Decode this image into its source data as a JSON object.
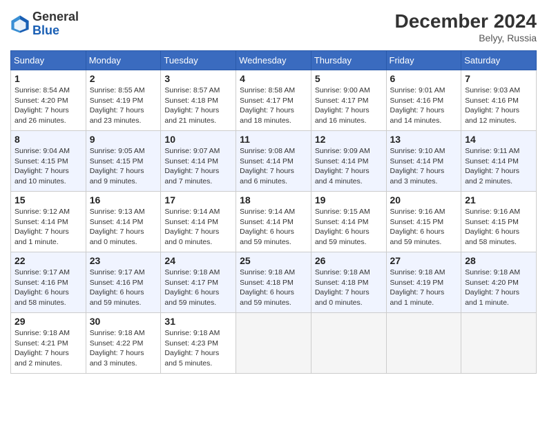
{
  "logo": {
    "text_general": "General",
    "text_blue": "Blue"
  },
  "header": {
    "month_year": "December 2024",
    "location": "Belyy, Russia"
  },
  "weekdays": [
    "Sunday",
    "Monday",
    "Tuesday",
    "Wednesday",
    "Thursday",
    "Friday",
    "Saturday"
  ],
  "weeks": [
    [
      {
        "day": "1",
        "sunrise": "8:54 AM",
        "sunset": "4:20 PM",
        "daylight": "7 hours and 26 minutes."
      },
      {
        "day": "2",
        "sunrise": "8:55 AM",
        "sunset": "4:19 PM",
        "daylight": "7 hours and 23 minutes."
      },
      {
        "day": "3",
        "sunrise": "8:57 AM",
        "sunset": "4:18 PM",
        "daylight": "7 hours and 21 minutes."
      },
      {
        "day": "4",
        "sunrise": "8:58 AM",
        "sunset": "4:17 PM",
        "daylight": "7 hours and 18 minutes."
      },
      {
        "day": "5",
        "sunrise": "9:00 AM",
        "sunset": "4:17 PM",
        "daylight": "7 hours and 16 minutes."
      },
      {
        "day": "6",
        "sunrise": "9:01 AM",
        "sunset": "4:16 PM",
        "daylight": "7 hours and 14 minutes."
      },
      {
        "day": "7",
        "sunrise": "9:03 AM",
        "sunset": "4:16 PM",
        "daylight": "7 hours and 12 minutes."
      }
    ],
    [
      {
        "day": "8",
        "sunrise": "9:04 AM",
        "sunset": "4:15 PM",
        "daylight": "7 hours and 10 minutes."
      },
      {
        "day": "9",
        "sunrise": "9:05 AM",
        "sunset": "4:15 PM",
        "daylight": "7 hours and 9 minutes."
      },
      {
        "day": "10",
        "sunrise": "9:07 AM",
        "sunset": "4:14 PM",
        "daylight": "7 hours and 7 minutes."
      },
      {
        "day": "11",
        "sunrise": "9:08 AM",
        "sunset": "4:14 PM",
        "daylight": "7 hours and 6 minutes."
      },
      {
        "day": "12",
        "sunrise": "9:09 AM",
        "sunset": "4:14 PM",
        "daylight": "7 hours and 4 minutes."
      },
      {
        "day": "13",
        "sunrise": "9:10 AM",
        "sunset": "4:14 PM",
        "daylight": "7 hours and 3 minutes."
      },
      {
        "day": "14",
        "sunrise": "9:11 AM",
        "sunset": "4:14 PM",
        "daylight": "7 hours and 2 minutes."
      }
    ],
    [
      {
        "day": "15",
        "sunrise": "9:12 AM",
        "sunset": "4:14 PM",
        "daylight": "7 hours and 1 minute."
      },
      {
        "day": "16",
        "sunrise": "9:13 AM",
        "sunset": "4:14 PM",
        "daylight": "7 hours and 0 minutes."
      },
      {
        "day": "17",
        "sunrise": "9:14 AM",
        "sunset": "4:14 PM",
        "daylight": "7 hours and 0 minutes."
      },
      {
        "day": "18",
        "sunrise": "9:14 AM",
        "sunset": "4:14 PM",
        "daylight": "6 hours and 59 minutes."
      },
      {
        "day": "19",
        "sunrise": "9:15 AM",
        "sunset": "4:14 PM",
        "daylight": "6 hours and 59 minutes."
      },
      {
        "day": "20",
        "sunrise": "9:16 AM",
        "sunset": "4:15 PM",
        "daylight": "6 hours and 59 minutes."
      },
      {
        "day": "21",
        "sunrise": "9:16 AM",
        "sunset": "4:15 PM",
        "daylight": "6 hours and 58 minutes."
      }
    ],
    [
      {
        "day": "22",
        "sunrise": "9:17 AM",
        "sunset": "4:16 PM",
        "daylight": "6 hours and 58 minutes."
      },
      {
        "day": "23",
        "sunrise": "9:17 AM",
        "sunset": "4:16 PM",
        "daylight": "6 hours and 59 minutes."
      },
      {
        "day": "24",
        "sunrise": "9:18 AM",
        "sunset": "4:17 PM",
        "daylight": "6 hours and 59 minutes."
      },
      {
        "day": "25",
        "sunrise": "9:18 AM",
        "sunset": "4:18 PM",
        "daylight": "6 hours and 59 minutes."
      },
      {
        "day": "26",
        "sunrise": "9:18 AM",
        "sunset": "4:18 PM",
        "daylight": "7 hours and 0 minutes."
      },
      {
        "day": "27",
        "sunrise": "9:18 AM",
        "sunset": "4:19 PM",
        "daylight": "7 hours and 1 minute."
      },
      {
        "day": "28",
        "sunrise": "9:18 AM",
        "sunset": "4:20 PM",
        "daylight": "7 hours and 1 minute."
      }
    ],
    [
      {
        "day": "29",
        "sunrise": "9:18 AM",
        "sunset": "4:21 PM",
        "daylight": "7 hours and 2 minutes."
      },
      {
        "day": "30",
        "sunrise": "9:18 AM",
        "sunset": "4:22 PM",
        "daylight": "7 hours and 3 minutes."
      },
      {
        "day": "31",
        "sunrise": "9:18 AM",
        "sunset": "4:23 PM",
        "daylight": "7 hours and 5 minutes."
      },
      null,
      null,
      null,
      null
    ]
  ]
}
